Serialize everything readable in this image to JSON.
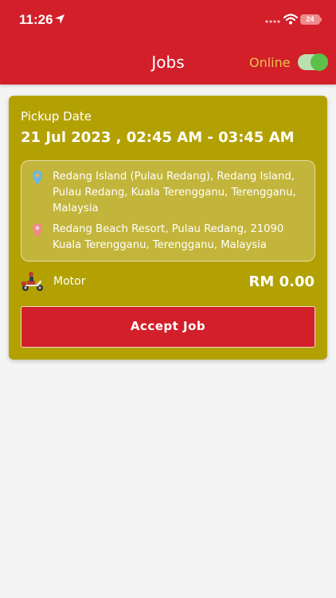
{
  "status_bar": {
    "time": "11:26",
    "battery": "24"
  },
  "header": {
    "title": "Jobs",
    "online_label": "Online",
    "online_toggle": "on"
  },
  "job": {
    "pickup_label": "Pickup Date",
    "pickup_datetime": "21 Jul 2023 , 02:45 AM - 03:45 AM",
    "origin_address": "Redang Island (Pulau Redang), Redang Island, Pulau Redang, Kuala Terengganu, Terengganu, Malaysia",
    "destination_address": "Redang Beach Resort, Pulau Redang, 21090 Kuala Terengganu, Terengganu, Malaysia",
    "vehicle": "Motor",
    "price": "RM 0.00",
    "accept_label": "Accept Job"
  },
  "colors": {
    "brand_red": "#d21f2a",
    "card_olive": "#b3a104",
    "online_gold": "#e8c44b",
    "toggle_green": "#5cbf4a",
    "origin_pin": "#6cb6e8",
    "destination_pin": "#ee8a8a"
  },
  "icons": {
    "status_location": "location-arrow-icon",
    "origin": "map-pin-icon",
    "destination": "map-pin-icon",
    "vehicle": "scooter-icon"
  }
}
